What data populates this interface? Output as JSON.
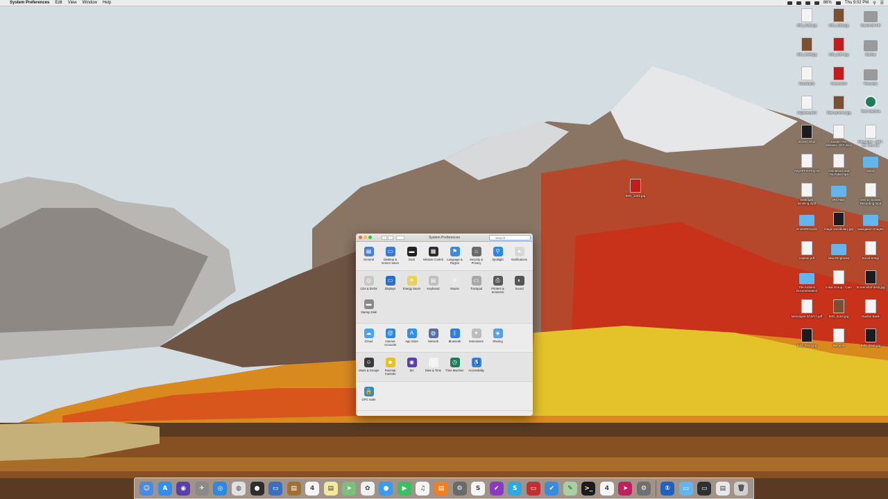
{
  "menubar": {
    "apple": "",
    "app_name": "System Preferences",
    "menus": [
      "Edit",
      "View",
      "Window",
      "Help"
    ],
    "clock": "Thu 9:02 PM",
    "battery": "86%"
  },
  "desktop_icons": [
    {
      "label": "IMG_0192.jpg",
      "kind": "doc"
    },
    {
      "label": "IMG_0193.jpg",
      "kind": "photo"
    },
    {
      "label": "Macintosh HD",
      "kind": "drive"
    },
    {
      "label": "IMG_0196.jpg",
      "kind": "photo"
    },
    {
      "label": "IMG_0197.jpg",
      "kind": "red"
    },
    {
      "label": "Backup",
      "kind": "drive"
    },
    {
      "label": "Downloads",
      "kind": "doc"
    },
    {
      "label": "Screenshot",
      "kind": "red"
    },
    {
      "label": "Recovery",
      "kind": "drive"
    },
    {
      "label": "ringtones.plist",
      "kind": "doc"
    },
    {
      "label": "fakemymemo.jpg",
      "kind": "photo"
    },
    {
      "label": "Time Machine",
      "kind": "tm"
    },
    {
      "label": "Screen Shot",
      "kind": "dark"
    },
    {
      "label": "Susan - FB Messen...017.docx",
      "kind": "doc"
    },
    {
      "label": "Messages - 2017-09...nes.one",
      "kind": "doc"
    },
    {
      "label": "ArtyAPFS-FAQ.txt",
      "kind": "doc"
    },
    {
      "label": "Animations and YouTube.mp4",
      "kind": "doc"
    },
    {
      "label": "Music",
      "kind": "folder"
    },
    {
      "label": "IMG_1202.jpg",
      "kind": "red"
    },
    {
      "label": "BSB with scrolling.mp4",
      "kind": "doc"
    },
    {
      "label": "IPA Files",
      "kind": "folder"
    },
    {
      "label": "iOS 11 Screen Recording.mp4",
      "kind": "doc"
    },
    {
      "label": "KnottsRecords",
      "kind": "folder"
    },
    {
      "label": "magic vocabulary.jpg",
      "kind": "dark"
    },
    {
      "label": "Navigation Images",
      "kind": "folder"
    },
    {
      "label": "caption.pdf",
      "kind": "doc"
    },
    {
      "label": "New Ringtones",
      "kind": "folder"
    },
    {
      "label": "Excel Setup",
      "kind": "doc"
    },
    {
      "label": "The Arduino Documentation",
      "kind": "folder"
    },
    {
      "label": "initial Group - Cam",
      "kind": "doc"
    },
    {
      "label": "Screenshot-deck.jpg",
      "kind": "dark"
    },
    {
      "label": "Messages-0/19/17.pdf",
      "kind": "doc"
    },
    {
      "label": "IMG_0154.jpg",
      "kind": "photo"
    },
    {
      "label": "Radius Bank",
      "kind": "doc"
    },
    {
      "label": "IMG_0244.jpg",
      "kind": "dark"
    },
    {
      "label": "Recurve",
      "kind": "doc"
    },
    {
      "label": "IMG_0246.jpg",
      "kind": "dark"
    }
  ],
  "window": {
    "title": "System Preferences",
    "search_placeholder": "Search",
    "sections": [
      [
        {
          "label": "General",
          "icon": "general-icon",
          "color": "#4a7fd0",
          "glyph": "▤"
        },
        {
          "label": "Desktop & Screen Saver",
          "icon": "desktop-icon",
          "color": "#3a7bd5",
          "glyph": "▭"
        },
        {
          "label": "Dock",
          "icon": "dock-icon",
          "color": "#222222",
          "glyph": "▬"
        },
        {
          "label": "Mission Control",
          "icon": "mission-control-icon",
          "color": "#2d2d2d",
          "glyph": "▦"
        },
        {
          "label": "Language & Region",
          "icon": "language-icon",
          "color": "#3d8ad8",
          "glyph": "⚑"
        },
        {
          "label": "Security & Privacy",
          "icon": "security-icon",
          "color": "#6b6b6b",
          "glyph": "⌂"
        },
        {
          "label": "Spotlight",
          "icon": "spotlight-icon",
          "color": "#2f88e0",
          "glyph": "⚲"
        },
        {
          "label": "Notifications",
          "icon": "notifications-icon",
          "color": "#d8d8d8",
          "glyph": "●"
        }
      ],
      [
        {
          "label": "CDs & DVDs",
          "icon": "cd-icon",
          "color": "#c8c8c8",
          "glyph": "◎"
        },
        {
          "label": "Displays",
          "icon": "displays-icon",
          "color": "#2b6fc8",
          "glyph": "▭"
        },
        {
          "label": "Energy Saver",
          "icon": "energy-icon",
          "color": "#e8d35a",
          "glyph": "☀"
        },
        {
          "label": "Keyboard",
          "icon": "keyboard-icon",
          "color": "#bfbfbf",
          "glyph": "▤"
        },
        {
          "label": "Mouse",
          "icon": "mouse-icon",
          "color": "#e6e6e6",
          "glyph": "◖"
        },
        {
          "label": "Trackpad",
          "icon": "trackpad-icon",
          "color": "#a8a8a8",
          "glyph": "▭"
        },
        {
          "label": "Printers & Scanners",
          "icon": "printer-icon",
          "color": "#5a5a5a",
          "glyph": "⎙"
        },
        {
          "label": "Sound",
          "icon": "sound-icon",
          "color": "#555555",
          "glyph": "◐"
        },
        {
          "label": "Startup Disk",
          "icon": "startup-disk-icon",
          "color": "#8a8a8a",
          "glyph": "▬"
        }
      ],
      [
        {
          "label": "iCloud",
          "icon": "icloud-icon",
          "color": "#4aa3f0",
          "glyph": "☁"
        },
        {
          "label": "Internet Accounts",
          "icon": "internet-accounts-icon",
          "color": "#2f88e0",
          "glyph": "@"
        },
        {
          "label": "App Store",
          "icon": "app-store-icon",
          "color": "#2f8ef0",
          "glyph": "A"
        },
        {
          "label": "Network",
          "icon": "network-icon",
          "color": "#5a6fa0",
          "glyph": "◍"
        },
        {
          "label": "Bluetooth",
          "icon": "bluetooth-icon",
          "color": "#2f7fe0",
          "glyph": "ᛒ"
        },
        {
          "label": "Extensions",
          "icon": "extensions-icon",
          "color": "#bdbdbd",
          "glyph": "✦"
        },
        {
          "label": "Sharing",
          "icon": "sharing-icon",
          "color": "#5aa0e0",
          "glyph": "◈"
        }
      ],
      [
        {
          "label": "Users & Groups",
          "icon": "users-icon",
          "color": "#3a3a3a",
          "glyph": "☺"
        },
        {
          "label": "Parental Controls",
          "icon": "parental-icon",
          "color": "#e8c020",
          "glyph": "☻"
        },
        {
          "label": "Siri",
          "icon": "siri-icon",
          "color": "#5b3fa8",
          "glyph": "◉"
        },
        {
          "label": "Date & Time",
          "icon": "date-time-icon",
          "color": "#f2f2f2",
          "glyph": "◷"
        },
        {
          "label": "Time Machine",
          "icon": "time-machine-icon",
          "color": "#1f7c5a",
          "glyph": "◷"
        },
        {
          "label": "Accessibility",
          "icon": "accessibility-icon",
          "color": "#2f88e0",
          "glyph": "♿"
        }
      ],
      [
        {
          "label": "GPG Suite",
          "icon": "gpg-suite-icon",
          "color": "#3a8ac0",
          "glyph": "🔒"
        }
      ]
    ]
  },
  "dock": [
    {
      "name": "finder-icon",
      "color": "#4a8ae0",
      "glyph": "☺"
    },
    {
      "name": "app-store-dock-icon",
      "color": "#2f8ef0",
      "glyph": "A"
    },
    {
      "name": "siri-dock-icon",
      "color": "#5b3fa8",
      "glyph": "◉"
    },
    {
      "name": "launchpad-icon",
      "color": "#8a8a8a",
      "glyph": "✈"
    },
    {
      "name": "safari-icon",
      "color": "#2f88e0",
      "glyph": "◎"
    },
    {
      "name": "chrome-icon",
      "color": "#e0e0e0",
      "glyph": "◍"
    },
    {
      "name": "podcast-app-icon",
      "color": "#2d2d2d",
      "glyph": "●"
    },
    {
      "name": "preview-icon",
      "color": "#3a6fc0",
      "glyph": "▭"
    },
    {
      "name": "notes-brown-icon",
      "color": "#a07030",
      "glyph": "▤"
    },
    {
      "name": "calendar-icon",
      "color": "#f5f5f5",
      "glyph": "4"
    },
    {
      "name": "notes-icon",
      "color": "#f5e9a0",
      "glyph": "▤"
    },
    {
      "name": "maps-icon",
      "color": "#7ac07a",
      "glyph": "➤"
    },
    {
      "name": "photos-icon",
      "color": "#f0f0f0",
      "glyph": "✿"
    },
    {
      "name": "messages-icon",
      "color": "#3a9af0",
      "glyph": "●"
    },
    {
      "name": "facetime-icon",
      "color": "#3ac060",
      "glyph": "▶"
    },
    {
      "name": "itunes-icon",
      "color": "#f5f5f5",
      "glyph": "♫"
    },
    {
      "name": "ibooks-icon",
      "color": "#f08020",
      "glyph": "▤"
    },
    {
      "name": "system-preferences-icon",
      "color": "#6a6a6a",
      "glyph": "⚙"
    },
    {
      "name": "slack-like-icon",
      "color": "#f5f5f5",
      "glyph": "S"
    },
    {
      "name": "omnifocus-icon",
      "color": "#8a3ac0",
      "glyph": "✔"
    },
    {
      "name": "skype-icon",
      "color": "#2fa8e0",
      "glyph": "S"
    },
    {
      "name": "screenshot-app-icon",
      "color": "#c03030",
      "glyph": "▭"
    },
    {
      "name": "things-icon",
      "color": "#3a8ae0",
      "glyph": "✔"
    },
    {
      "name": "script-editor-icon",
      "color": "#a8d0a0",
      "glyph": "✎"
    },
    {
      "name": "terminal-icon",
      "color": "#1c1c1c",
      "glyph": ">_"
    },
    {
      "name": "calendar-2-icon",
      "color": "#f5f5f5",
      "glyph": "4"
    },
    {
      "name": "prompt-icon",
      "color": "#c02060",
      "glyph": "➤"
    },
    {
      "name": "automator-icon",
      "color": "#707070",
      "glyph": "⚙"
    },
    {
      "name": "1password-icon",
      "color": "#2060c0",
      "glyph": "①"
    },
    {
      "name": "downloads-folder-icon",
      "color": "#63b5ee",
      "glyph": "▭"
    },
    {
      "name": "screenshots-stack-icon",
      "color": "#303030",
      "glyph": "▭"
    },
    {
      "name": "documents-stack-icon",
      "color": "#e8e8e8",
      "glyph": "▤"
    },
    {
      "name": "trash-icon",
      "color": "#d0d0d0",
      "glyph": "🗑"
    }
  ]
}
